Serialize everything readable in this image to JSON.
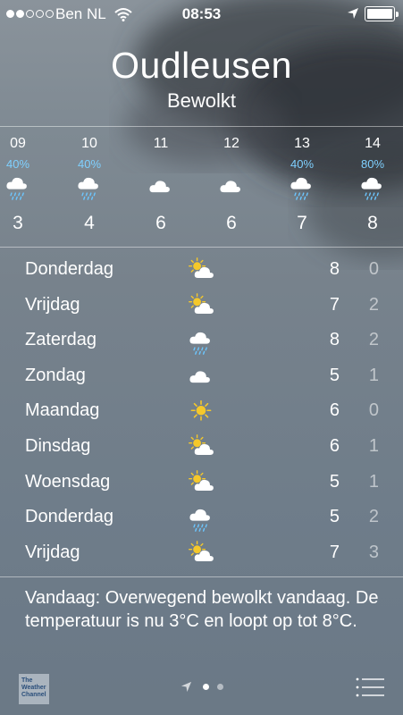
{
  "status_bar": {
    "carrier": "Ben NL",
    "time": "08:53",
    "signal_bars_filled": 2,
    "signal_bars_total": 5,
    "battery_level": 1.0
  },
  "location": {
    "city": "Oudleusen",
    "condition": "Bewolkt"
  },
  "hourly": [
    {
      "time": "09",
      "precip": "40%",
      "icon": "cloud-rain-icon",
      "temp": "3"
    },
    {
      "time": "10",
      "precip": "40%",
      "icon": "cloud-rain-icon",
      "temp": "4"
    },
    {
      "time": "11",
      "precip": "",
      "icon": "cloud-icon",
      "temp": "6"
    },
    {
      "time": "12",
      "precip": "",
      "icon": "cloud-icon",
      "temp": "6"
    },
    {
      "time": "13",
      "precip": "40%",
      "icon": "cloud-rain-icon",
      "temp": "7"
    },
    {
      "time": "14",
      "precip": "80%",
      "icon": "cloud-rain-icon",
      "temp": "8"
    }
  ],
  "daily": [
    {
      "day": "Donderdag",
      "icon": "partly-cloudy-icon",
      "high": "8",
      "low": "0"
    },
    {
      "day": "Vrijdag",
      "icon": "partly-cloudy-icon",
      "high": "7",
      "low": "2"
    },
    {
      "day": "Zaterdag",
      "icon": "cloud-rain-icon",
      "high": "8",
      "low": "2"
    },
    {
      "day": "Zondag",
      "icon": "cloud-icon",
      "high": "5",
      "low": "1"
    },
    {
      "day": "Maandag",
      "icon": "sun-icon",
      "high": "6",
      "low": "0"
    },
    {
      "day": "Dinsdag",
      "icon": "partly-cloudy-icon",
      "high": "6",
      "low": "1"
    },
    {
      "day": "Woensdag",
      "icon": "partly-cloudy-icon",
      "high": "5",
      "low": "1"
    },
    {
      "day": "Donderdag",
      "icon": "cloud-rain-icon",
      "high": "5",
      "low": "2"
    },
    {
      "day": "Vrijdag",
      "icon": "partly-cloudy-icon",
      "high": "7",
      "low": "3"
    }
  ],
  "summary": "Vandaag: Overwegend bewolkt vandaag. De temperatuur is nu 3°C en loopt op tot 8°C.",
  "toolbar": {
    "logo_text": "The Weather Channel",
    "page_count": 3,
    "active_page": 1
  },
  "colors": {
    "precip_text": "#7fd0ff",
    "sun": "#f5c82a",
    "rain": "#6cc6ff"
  }
}
